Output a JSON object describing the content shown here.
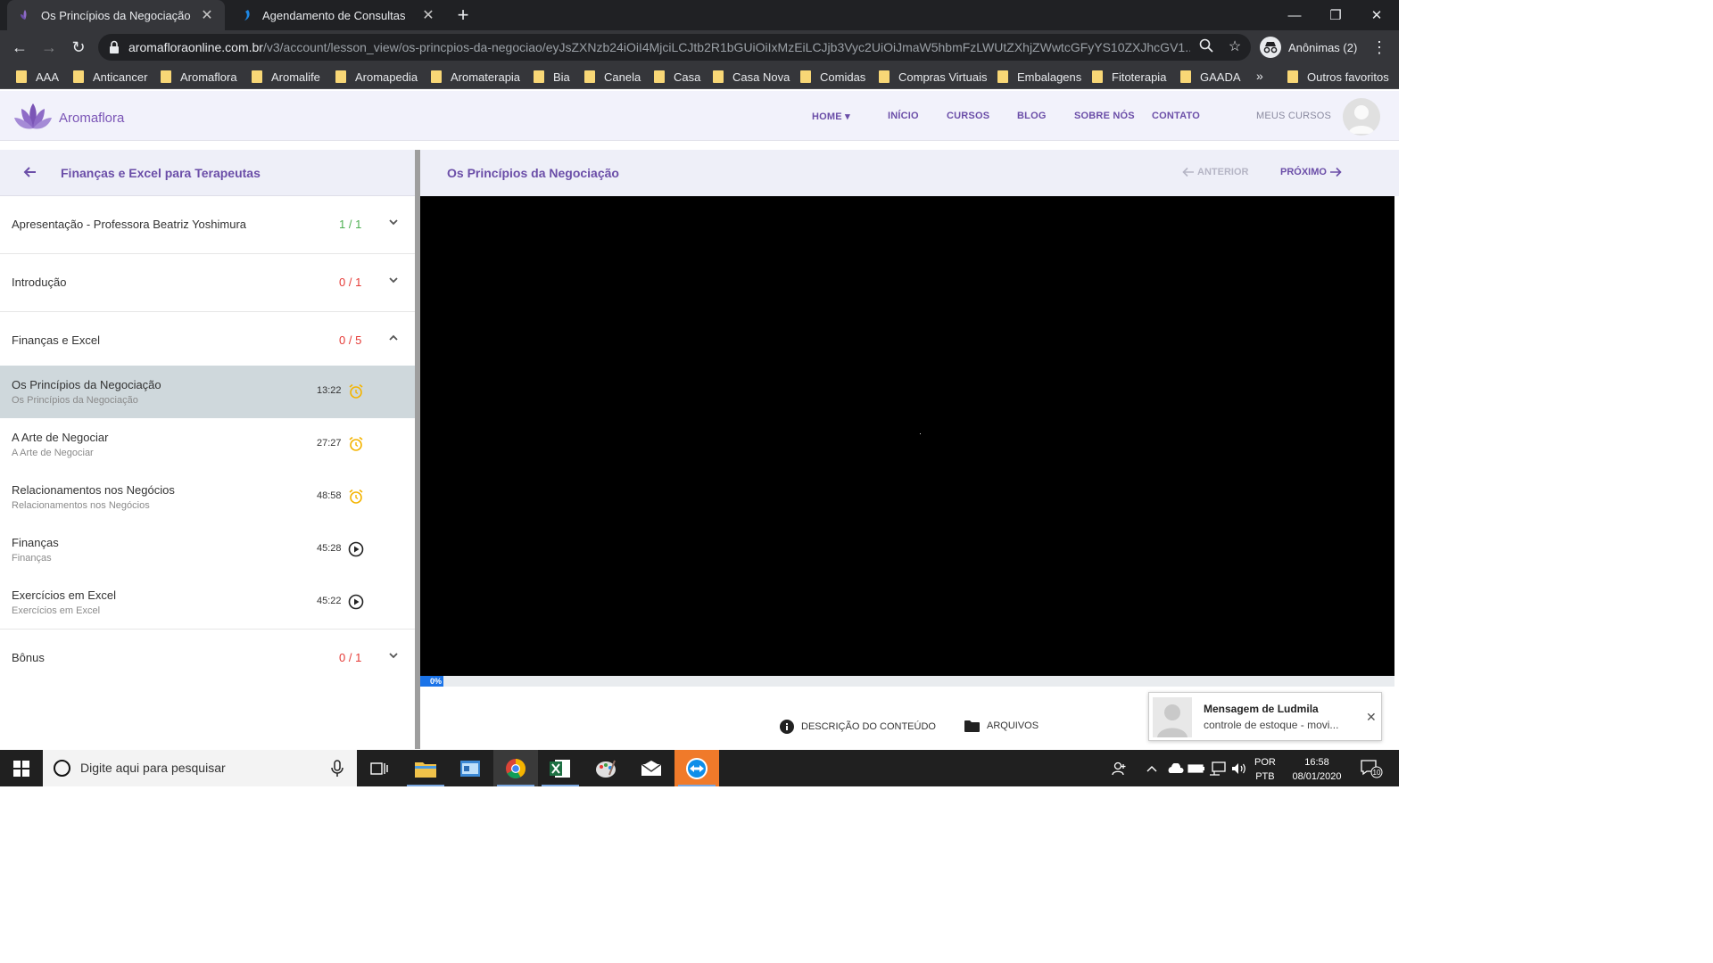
{
  "browser": {
    "tabs": [
      {
        "title": "Os Princípios da Negociação",
        "active": true
      },
      {
        "title": "Agendamento de Consultas",
        "active": false
      }
    ],
    "url_host": "aromafloraonline.com.br",
    "url_path": "/v3/account/lesson_view/os-princpios-da-negociao/eyJsZXNzb24iOiI4MjciLCJtb2R1bGUiOiIxMzEiLCJjb3Vyc2UiOiJmaW5hbmFzLWUtZXhjZWwtcGFyYS10ZXJhcGV1...",
    "profile_label": "Anônimas (2)",
    "bookmarks": [
      "AAA",
      "Anticancer",
      "Aromaflora",
      "Aromalife",
      "Aromapedia",
      "Aromaterapia",
      "Bia",
      "Canela",
      "Casa",
      "Casa Nova",
      "Comidas",
      "Compras Virtuais",
      "Embalagens",
      "Fitoterapia",
      "GAADA"
    ],
    "bookmarks_overflow": "»",
    "other_bookmarks": "Outros favoritos"
  },
  "site": {
    "brand": "Aromaflora",
    "nav": {
      "home": "HOME",
      "inicio": "INÍCIO",
      "cursos": "CURSOS",
      "blog": "BLOG",
      "sobre": "SOBRE NÓS",
      "contato": "CONTATO",
      "meus_cursos": "MEUS CURSOS"
    }
  },
  "course": {
    "title": "Finanças e Excel para Terapeutas",
    "sections": [
      {
        "label": "Apresentação - Professora Beatriz Yoshimura",
        "count": "1 / 1",
        "status": "complete"
      },
      {
        "label": "Introdução",
        "count": "0 / 1",
        "status": "incomplete"
      },
      {
        "label": "Finanças e Excel",
        "count": "0 / 5",
        "status": "incomplete",
        "expanded": true
      },
      {
        "label": "Bônus",
        "count": "0 / 1",
        "status": "incomplete"
      }
    ],
    "lessons": [
      {
        "title": "Os Princípios da Negociação",
        "subtitle": "Os Princípios da Negociação",
        "duration": "13:22",
        "icon": "alarm-icon",
        "active": true
      },
      {
        "title": "A Arte de Negociar",
        "subtitle": "A Arte de Negociar",
        "duration": "27:27",
        "icon": "alarm-icon"
      },
      {
        "title": "Relacionamentos nos Negócios",
        "subtitle": "Relacionamentos nos Negócios",
        "duration": "48:58",
        "icon": "alarm-icon"
      },
      {
        "title": "Finanças",
        "subtitle": "Finanças",
        "duration": "45:28",
        "icon": "play-circle-icon"
      },
      {
        "title": "Exercícios em Excel",
        "subtitle": "Exercícios em Excel",
        "duration": "45:22",
        "icon": "play-circle-icon"
      }
    ]
  },
  "lesson_view": {
    "title": "Os Princípios da Negociação",
    "prev_label": "ANTERIOR",
    "next_label": "PRÓXIMO",
    "progress_label": "0%",
    "progress_value": 0,
    "tab_description": "DESCRIÇÃO DO CONTEÚDO",
    "tab_files": "ARQUIVOS"
  },
  "notification": {
    "from": "Mensagem de Ludmila",
    "message": "controle de estoque - movi..."
  },
  "taskbar": {
    "search_placeholder": "Digite aqui para pesquisar",
    "lang_top": "POR",
    "lang_bottom": "PTB",
    "time": "16:58",
    "date": "08/01/2020",
    "notif_count": "10"
  },
  "colors": {
    "accent": "#6b4ea8",
    "complete": "#4caf50",
    "incomplete": "#e53935",
    "alarm": "#f4b400"
  }
}
